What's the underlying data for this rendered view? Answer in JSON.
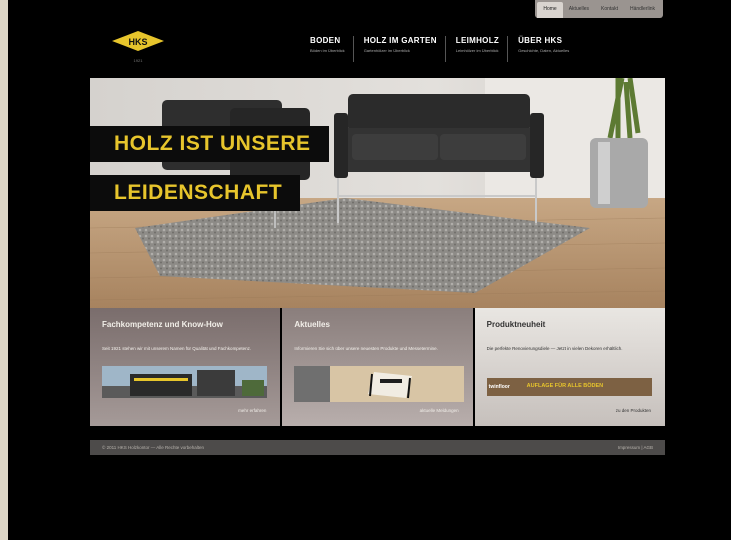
{
  "topnav": [
    "Home",
    "Aktuelles",
    "Kontakt",
    "Händlerlink"
  ],
  "logo": {
    "text": "HKS",
    "sub": "1921"
  },
  "mainnav": [
    {
      "title": "BODEN",
      "sub": "Böden im Überblick"
    },
    {
      "title": "HOLZ IM GARTEN",
      "sub": "Gartenhölzer im Überblick"
    },
    {
      "title": "LEIMHOLZ",
      "sub": "Leimhölzer im Überblick"
    },
    {
      "title": "ÜBER HKS",
      "sub": "Geschichte, Daten, Aktuelles"
    }
  ],
  "hero": {
    "line1": "HOLZ IST UNSERE",
    "line2": "LEIDENSCHAFT"
  },
  "boxes": [
    {
      "title": "Fachkompetenz und Know-How",
      "text": "Seit 1921 stehen wir mit unserem Namen für Qualität und Fachkompetenz.",
      "more": "mehr erfahren"
    },
    {
      "title": "Aktuelles",
      "text": "Informieren Sie sich über unsere neuesten Produkte und Messetermine.",
      "more": "aktuelle Meldungen"
    },
    {
      "title": "Produktneuheit",
      "text": "Die perfekte Renovierungsdiele — Jetzt in vielen Dekoren erhältlich.",
      "more": "zu den Produkten",
      "banner": "AUFLAGE FÜR ALLE BÖDEN"
    }
  ],
  "footer": {
    "left": "© 2011 HKS Holzkontor — Alle Rechte vorbehalten",
    "right": "Impressum | AGB"
  }
}
